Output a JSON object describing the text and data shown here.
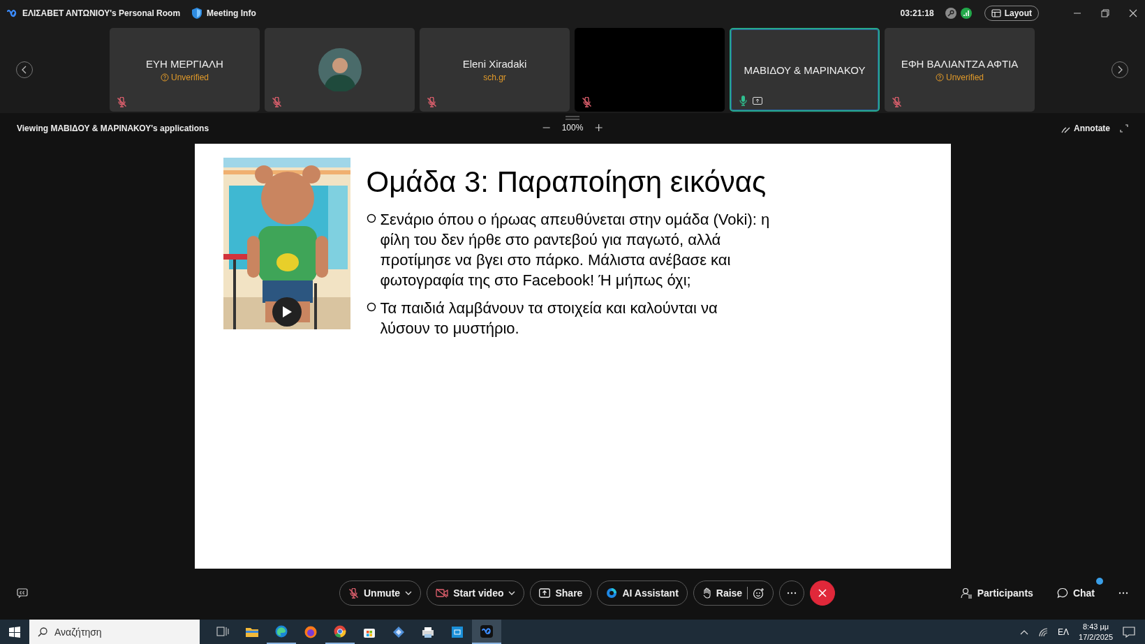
{
  "window": {
    "title": "ΕΛΙΣΑΒΕΤ ΑΝΤΩΝΙΟΥ's Personal Room",
    "meeting_info": "Meeting Info",
    "timer": "03:21:18",
    "layout_button": "Layout"
  },
  "participants": [
    {
      "kind": "name",
      "name": "ΕΥΗ ΜΕΡΓΙΑΛΗ",
      "subtitle": "Unverified",
      "unverified": true,
      "muted": true,
      "active": false
    },
    {
      "kind": "avatar",
      "muted": true,
      "active": false
    },
    {
      "kind": "name",
      "name": "Eleni Xiradaki",
      "subtitle": "sch.gr",
      "unverified": false,
      "muted": true,
      "active": false
    },
    {
      "kind": "video",
      "muted": true,
      "active": false
    },
    {
      "kind": "name",
      "name": "ΜΑΒΙΔΟΥ & ΜΑΡΙΝΑΚΟΥ",
      "muted": false,
      "sharing": true,
      "active": true
    },
    {
      "kind": "name",
      "name": "ΕΦΗ ΒΑΛΙΑΝΤΖΑ ΑΦΤΙΑ",
      "subtitle": "Unverified",
      "unverified": true,
      "muted": true,
      "active": false
    }
  ],
  "share_bar": {
    "viewing": "Viewing ΜΑΒΙΔΟΥ & ΜΑΡΙΝΑΚΟΥ's applications",
    "zoom": "100%",
    "annotate": "Annotate"
  },
  "slide": {
    "title": "Ομάδα 3: Παραποίηση εικόνας",
    "video": {
      "kind": "picture"
    },
    "bullets": [
      "Σενάριο όπου ο ήρωας απευθύνεται στην ομάδα (Voki): η φίλη του δεν ήρθε στο ραντεβού για παγωτό, αλλά προτίμησε να βγει στο πάρκο. Μάλιστα ανέβασε και φωτογραφία της στο Facebook! Ή μήπως όχι;",
      "Τα παιδιά λαμβάνουν τα στοιχεία και καλούνται να λύσουν το μυστήριο."
    ]
  },
  "controls": [
    {
      "kind": "mic",
      "label": "Unmute",
      "dropdown": true
    },
    {
      "kind": "video",
      "label": "Start video",
      "dropdown": true
    },
    {
      "kind": "share",
      "label": "Share"
    },
    {
      "kind": "ai",
      "label": "AI Assistant"
    },
    {
      "kind": "raise",
      "label": "Raise"
    },
    {
      "kind": "more"
    },
    {
      "kind": "leave"
    }
  ],
  "side_controls": [
    {
      "kind": "participants",
      "label": "Participants"
    },
    {
      "kind": "chat",
      "label": "Chat",
      "unread": true
    },
    {
      "kind": "more"
    }
  ],
  "taskbar": {
    "search": {
      "placeholder": "Αναζήτηση"
    },
    "apps": [
      {
        "kind": "task-view",
        "running": false,
        "selected": false
      },
      {
        "kind": "folder",
        "running": false,
        "selected": false
      },
      {
        "kind": "edge",
        "running": true,
        "selected": false
      },
      {
        "kind": "firefox",
        "running": false,
        "selected": false
      },
      {
        "kind": "chrome",
        "running": true,
        "selected": false
      },
      {
        "kind": "store",
        "running": false,
        "selected": false
      },
      {
        "kind": "diamond",
        "running": false,
        "selected": false
      },
      {
        "kind": "printer",
        "running": false,
        "selected": false
      },
      {
        "kind": "tile",
        "running": false,
        "selected": false
      },
      {
        "kind": "webex",
        "running": true,
        "selected": true
      }
    ],
    "language": "ΕΛ",
    "time": "8:43 μμ",
    "date": "17/2/2025"
  }
}
